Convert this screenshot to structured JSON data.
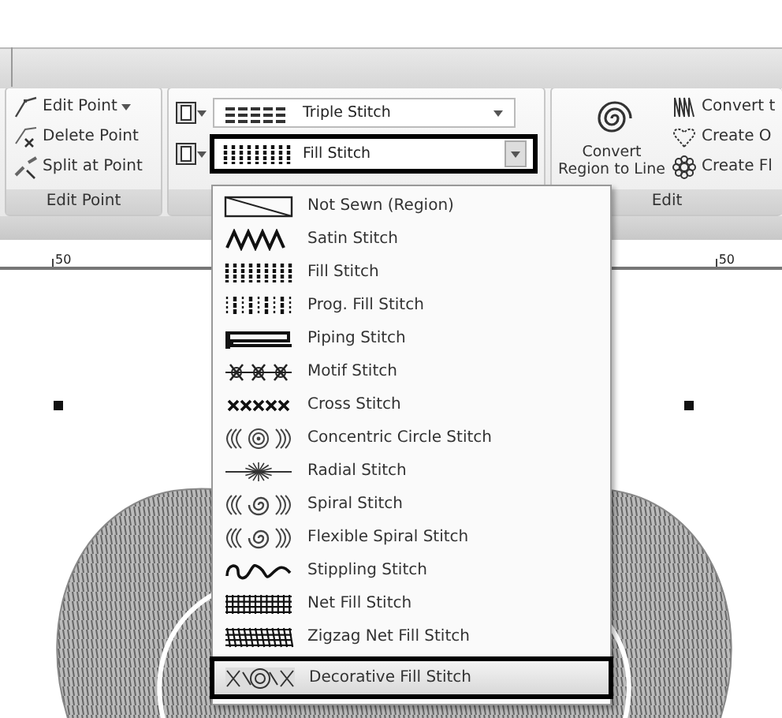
{
  "ribbon": {
    "edit_point_group": {
      "items": [
        {
          "label": "Edit Point",
          "kind": "edit_menu"
        },
        {
          "label": "Delete Point",
          "kind": "delete"
        },
        {
          "label": "Split at Point",
          "kind": "split"
        }
      ],
      "label": "Edit Point"
    },
    "stitch_group": {
      "line_combo": {
        "value": "Triple Stitch",
        "kind": "triple"
      },
      "region_combo": {
        "value": "Fill Stitch",
        "kind": "fill",
        "highlighted": true
      }
    },
    "edit_group": {
      "big_button": {
        "label": "Convert Region to Line"
      },
      "items": [
        {
          "label": "Convert t",
          "kind": "zigzag"
        },
        {
          "label": "Create O",
          "kind": "heart"
        },
        {
          "label": "Create Fl",
          "kind": "flower"
        }
      ],
      "label": "Edit"
    }
  },
  "ruler": {
    "labels": [
      "50",
      "50"
    ]
  },
  "dropdown": {
    "items": [
      {
        "label": "Not Sewn (Region)",
        "kind": "not_sewn",
        "selected": false
      },
      {
        "label": "Satin Stitch",
        "kind": "satin",
        "selected": false
      },
      {
        "label": "Fill Stitch",
        "kind": "fill",
        "selected": false
      },
      {
        "label": "Prog. Fill Stitch",
        "kind": "prog_fill",
        "selected": false
      },
      {
        "label": "Piping Stitch",
        "kind": "piping",
        "selected": false
      },
      {
        "label": "Motif Stitch",
        "kind": "motif",
        "selected": false
      },
      {
        "label": "Cross Stitch",
        "kind": "cross",
        "selected": false
      },
      {
        "label": "Concentric Circle Stitch",
        "kind": "concentric",
        "selected": false
      },
      {
        "label": "Radial Stitch",
        "kind": "radial",
        "selected": false
      },
      {
        "label": "Spiral Stitch",
        "kind": "spiral",
        "selected": false
      },
      {
        "label": "Flexible Spiral Stitch",
        "kind": "flex_spiral",
        "selected": false
      },
      {
        "label": "Stippling Stitch",
        "kind": "stippling",
        "selected": false
      },
      {
        "label": "Net Fill Stitch",
        "kind": "net",
        "selected": false
      },
      {
        "label": "Zigzag Net Fill Stitch",
        "kind": "zigzag_net",
        "selected": false
      },
      {
        "label": "Decorative Fill Stitch",
        "kind": "decorative",
        "selected": true
      }
    ]
  }
}
